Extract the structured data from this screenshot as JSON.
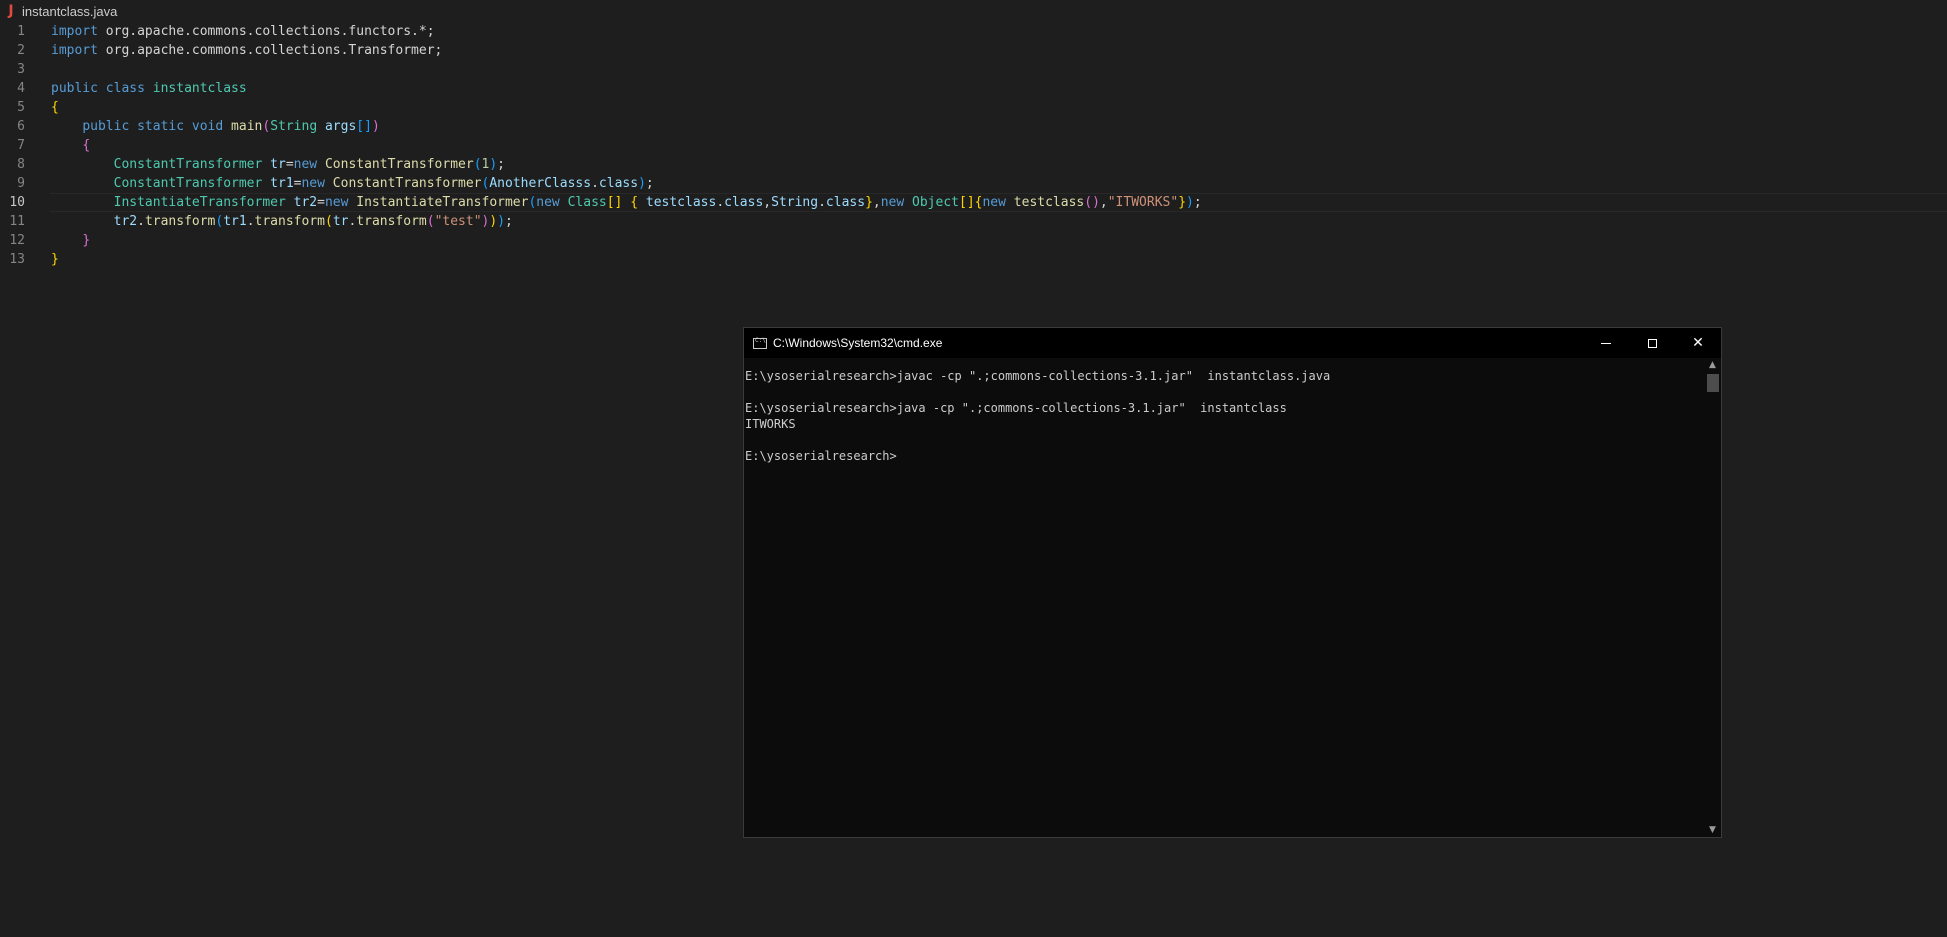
{
  "editor": {
    "tab": {
      "icon": "java-file-icon",
      "icon_glyph": "J",
      "filename": "instantclass.java"
    },
    "current_line": 10,
    "lines": [
      {
        "num": "1",
        "tokens": [
          {
            "c": "k",
            "t": "import"
          },
          {
            "c": "p",
            "t": " org.apache.commons.collections.functors.*;"
          }
        ]
      },
      {
        "num": "2",
        "tokens": [
          {
            "c": "k",
            "t": "import"
          },
          {
            "c": "p",
            "t": " org.apache.commons.collections.Transformer;"
          }
        ]
      },
      {
        "num": "3",
        "tokens": []
      },
      {
        "num": "4",
        "tokens": [
          {
            "c": "k",
            "t": "public"
          },
          {
            "c": "p",
            "t": " "
          },
          {
            "c": "k",
            "t": "class"
          },
          {
            "c": "p",
            "t": " "
          },
          {
            "c": "t",
            "t": "instantclass"
          }
        ]
      },
      {
        "num": "5",
        "tokens": [
          {
            "c": "b1",
            "t": "{"
          }
        ]
      },
      {
        "num": "6",
        "tokens": [
          {
            "c": "p",
            "t": "    "
          },
          {
            "c": "k",
            "t": "public"
          },
          {
            "c": "p",
            "t": " "
          },
          {
            "c": "k",
            "t": "static"
          },
          {
            "c": "p",
            "t": " "
          },
          {
            "c": "k",
            "t": "void"
          },
          {
            "c": "p",
            "t": " "
          },
          {
            "c": "f",
            "t": "main"
          },
          {
            "c": "b2",
            "t": "("
          },
          {
            "c": "t",
            "t": "String"
          },
          {
            "c": "p",
            "t": " "
          },
          {
            "c": "v",
            "t": "args"
          },
          {
            "c": "b3",
            "t": "[]"
          },
          {
            "c": "b2",
            "t": ")"
          }
        ]
      },
      {
        "num": "7",
        "tokens": [
          {
            "c": "p",
            "t": "    "
          },
          {
            "c": "b2",
            "t": "{"
          }
        ]
      },
      {
        "num": "8",
        "tokens": [
          {
            "c": "p",
            "t": "        "
          },
          {
            "c": "t",
            "t": "ConstantTransformer"
          },
          {
            "c": "p",
            "t": " "
          },
          {
            "c": "v",
            "t": "tr"
          },
          {
            "c": "p",
            "t": "="
          },
          {
            "c": "k",
            "t": "new"
          },
          {
            "c": "p",
            "t": " "
          },
          {
            "c": "f",
            "t": "ConstantTransformer"
          },
          {
            "c": "b3",
            "t": "("
          },
          {
            "c": "n",
            "t": "1"
          },
          {
            "c": "b3",
            "t": ")"
          },
          {
            "c": "p",
            "t": ";"
          }
        ]
      },
      {
        "num": "9",
        "tokens": [
          {
            "c": "p",
            "t": "        "
          },
          {
            "c": "t",
            "t": "ConstantTransformer"
          },
          {
            "c": "p",
            "t": " "
          },
          {
            "c": "v",
            "t": "tr1"
          },
          {
            "c": "p",
            "t": "="
          },
          {
            "c": "k",
            "t": "new"
          },
          {
            "c": "p",
            "t": " "
          },
          {
            "c": "f",
            "t": "ConstantTransformer"
          },
          {
            "c": "b3",
            "t": "("
          },
          {
            "c": "v",
            "t": "AnotherClasss"
          },
          {
            "c": "p",
            "t": "."
          },
          {
            "c": "v",
            "t": "class"
          },
          {
            "c": "b3",
            "t": ")"
          },
          {
            "c": "p",
            "t": ";"
          }
        ]
      },
      {
        "num": "10",
        "tokens": [
          {
            "c": "p",
            "t": "        "
          },
          {
            "c": "t",
            "t": "InstantiateTransformer"
          },
          {
            "c": "p",
            "t": " "
          },
          {
            "c": "v",
            "t": "tr2"
          },
          {
            "c": "p",
            "t": "="
          },
          {
            "c": "k",
            "t": "new"
          },
          {
            "c": "p",
            "t": " "
          },
          {
            "c": "f",
            "t": "InstantiateTransformer"
          },
          {
            "c": "b3",
            "t": "("
          },
          {
            "c": "k",
            "t": "new"
          },
          {
            "c": "p",
            "t": " "
          },
          {
            "c": "t",
            "t": "Class"
          },
          {
            "c": "b1",
            "t": "[]"
          },
          {
            "c": "p",
            "t": " "
          },
          {
            "c": "b1",
            "t": "{"
          },
          {
            "c": "p",
            "t": " "
          },
          {
            "c": "v",
            "t": "testclass"
          },
          {
            "c": "p",
            "t": "."
          },
          {
            "c": "v",
            "t": "class"
          },
          {
            "c": "p",
            "t": ","
          },
          {
            "c": "v",
            "t": "String"
          },
          {
            "c": "p",
            "t": "."
          },
          {
            "c": "v",
            "t": "class"
          },
          {
            "c": "b1",
            "t": "}"
          },
          {
            "c": "p",
            "t": ","
          },
          {
            "c": "k",
            "t": "new"
          },
          {
            "c": "p",
            "t": " "
          },
          {
            "c": "t",
            "t": "Object"
          },
          {
            "c": "b1",
            "t": "[]{"
          },
          {
            "c": "k",
            "t": "new"
          },
          {
            "c": "p",
            "t": " "
          },
          {
            "c": "f",
            "t": "testclass"
          },
          {
            "c": "b2",
            "t": "()"
          },
          {
            "c": "p",
            "t": ","
          },
          {
            "c": "s",
            "t": "\"ITWORKS\""
          },
          {
            "c": "b1",
            "t": "}"
          },
          {
            "c": "b3",
            "t": ")"
          },
          {
            "c": "p",
            "t": ";"
          }
        ]
      },
      {
        "num": "11",
        "tokens": [
          {
            "c": "p",
            "t": "        "
          },
          {
            "c": "v",
            "t": "tr2"
          },
          {
            "c": "p",
            "t": "."
          },
          {
            "c": "f",
            "t": "transform"
          },
          {
            "c": "b3",
            "t": "("
          },
          {
            "c": "v",
            "t": "tr1"
          },
          {
            "c": "p",
            "t": "."
          },
          {
            "c": "f",
            "t": "transform"
          },
          {
            "c": "b1",
            "t": "("
          },
          {
            "c": "v",
            "t": "tr"
          },
          {
            "c": "p",
            "t": "."
          },
          {
            "c": "f",
            "t": "transform"
          },
          {
            "c": "b2",
            "t": "("
          },
          {
            "c": "s",
            "t": "\"test\""
          },
          {
            "c": "b2",
            "t": ")"
          },
          {
            "c": "b1",
            "t": ")"
          },
          {
            "c": "b3",
            "t": ")"
          },
          {
            "c": "p",
            "t": ";"
          }
        ]
      },
      {
        "num": "12",
        "tokens": [
          {
            "c": "p",
            "t": "    "
          },
          {
            "c": "b2",
            "t": "}"
          }
        ]
      },
      {
        "num": "13",
        "tokens": [
          {
            "c": "b1",
            "t": "}"
          }
        ]
      }
    ]
  },
  "cmd": {
    "title": "C:\\Windows\\System32\\cmd.exe",
    "icon": "cmd-console-icon",
    "buttons": {
      "minimize": "minimize-icon",
      "maximize": "maximize-icon",
      "close": "close-icon",
      "close_glyph": "✕"
    },
    "scroll_up_glyph": "▲",
    "scroll_down_glyph": "▼",
    "output": [
      "E:\\ysoserialresearch>javac -cp \".;commons-collections-3.1.jar\"  instantclass.java",
      "",
      "E:\\ysoserialresearch>java -cp \".;commons-collections-3.1.jar\"  instantclass",
      "ITWORKS",
      "",
      "E:\\ysoserialresearch>"
    ]
  }
}
